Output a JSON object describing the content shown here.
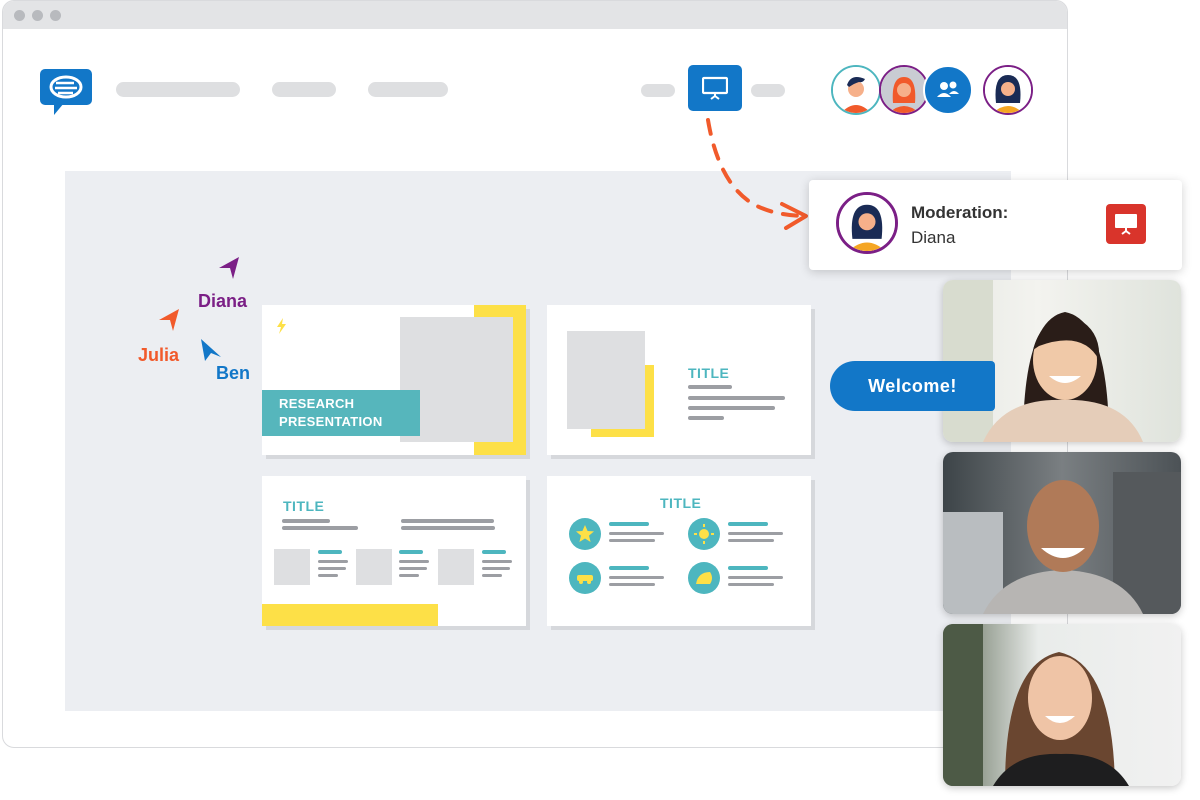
{
  "toolbar": {
    "present_button": "presentation-screen-icon"
  },
  "participants": [
    "man-avatar",
    "woman-red-hair-avatar",
    "group-icon",
    "diana-avatar"
  ],
  "cursors": [
    {
      "name": "Diana",
      "color": "#7b1f86"
    },
    {
      "name": "Julia",
      "color": "#f15a2b"
    },
    {
      "name": "Ben",
      "color": "#1277c8"
    }
  ],
  "slides": {
    "cover": {
      "line1": "RESEARCH",
      "line2": "PRESENTATION"
    },
    "slide2": {
      "title": "TITLE"
    },
    "slide3": {
      "title": "TITLE"
    },
    "slide4": {
      "title": "TITLE"
    }
  },
  "moderation": {
    "label": "Moderation:",
    "name": "Diana"
  },
  "chat": {
    "welcome": "Welcome!"
  },
  "colors": {
    "brand_blue": "#1277c8",
    "accent_teal": "#4db6bf",
    "accent_yellow": "#fde047",
    "arrow_orange": "#f15a2b"
  }
}
